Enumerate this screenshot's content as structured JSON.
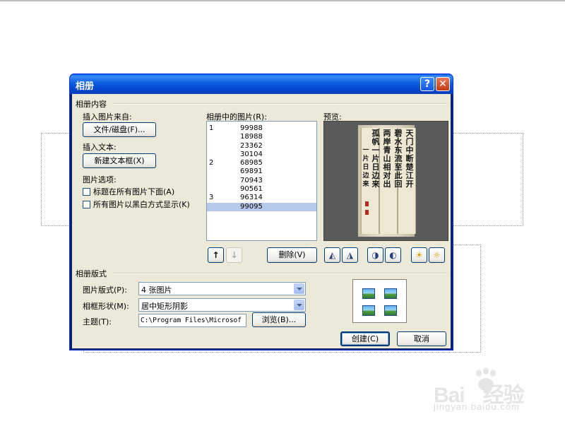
{
  "dialog": {
    "title": "相册",
    "help_glyph": "?",
    "close_glyph": "✕"
  },
  "album_content": {
    "group_label": "相册内容",
    "insert_from_label": "插入图片来自:",
    "file_disk_button": "文件/磁盘(F)...",
    "insert_text_label": "插入文本:",
    "new_textbox_button": "新建文本框(X)",
    "picture_options_label": "图片选项:",
    "options": [
      {
        "label": "标题在所有图片下面(A)",
        "checked": false
      },
      {
        "label": "所有图片以黑白方式显示(K)",
        "checked": false
      }
    ]
  },
  "pictures": {
    "label": "相册中的图片(R):",
    "rows": [
      {
        "num": "1",
        "name": "99988",
        "selected": false
      },
      {
        "num": "",
        "name": "18988",
        "selected": false
      },
      {
        "num": "",
        "name": "23362",
        "selected": false
      },
      {
        "num": "",
        "name": "30104",
        "selected": false
      },
      {
        "num": "2",
        "name": "68985",
        "selected": false
      },
      {
        "num": "",
        "name": "69891",
        "selected": false
      },
      {
        "num": "",
        "name": "70943",
        "selected": false
      },
      {
        "num": "",
        "name": "90561",
        "selected": false
      },
      {
        "num": "3",
        "name": "96314",
        "selected": false
      },
      {
        "num": "",
        "name": "99095",
        "selected": true
      }
    ],
    "move_up_glyph": "↑",
    "move_down_glyph": "↓",
    "delete_button": "删除(V)"
  },
  "preview": {
    "label": "预览:",
    "tool_icons": [
      "rotate-left-icon",
      "rotate-right-icon",
      "contrast-up-icon",
      "contrast-down-icon",
      "brightness-up-icon",
      "brightness-down-icon"
    ],
    "tool_glyphs": [
      "◭",
      "◮",
      "◑",
      "◐",
      "☀",
      "☼"
    ]
  },
  "album_layout": {
    "group_label": "相册版式",
    "picture_layout_label": "图片版式(P):",
    "picture_layout_value": "4 张图片",
    "frame_shape_label": "相框形状(M):",
    "frame_shape_value": "居中矩形阴影",
    "theme_label": "主题(T):",
    "theme_value": "C:\\Program Files\\Microsof",
    "browse_button": "浏览(B)...",
    "create_button": "创建(C)",
    "cancel_button": "取消"
  },
  "watermark": {
    "brand": "Bai",
    "brand_suffix": "经验",
    "url": "jingyan.baidu.com"
  },
  "colors": {
    "titlebar": "#0a5fe0",
    "dialog_face": "#ece9d8",
    "selection": "#b6c9ea"
  }
}
